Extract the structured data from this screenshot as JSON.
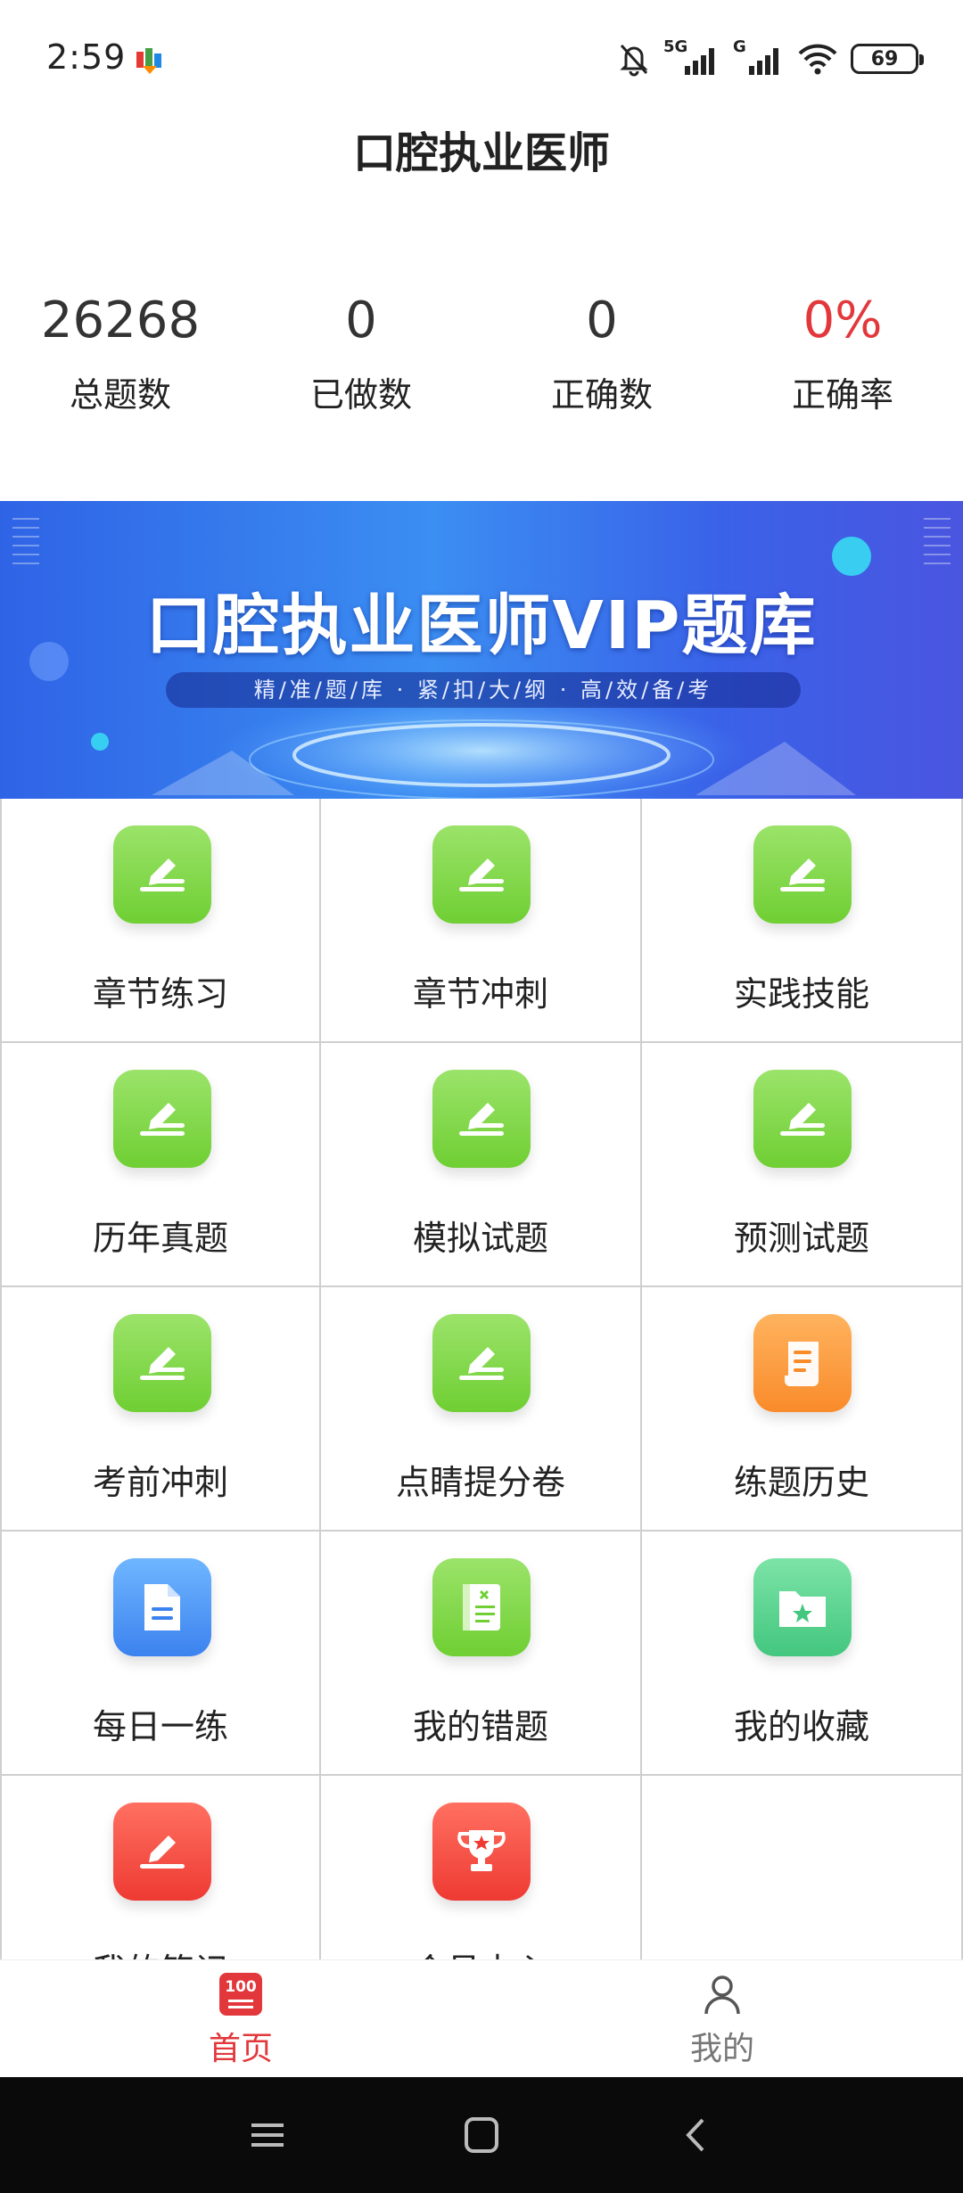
{
  "status_bar": {
    "time": "2:59",
    "network_1": "5G",
    "network_2": "G",
    "battery": "69"
  },
  "header": {
    "title": "口腔执业医师"
  },
  "stats": [
    {
      "value": "26268",
      "label": "总题数"
    },
    {
      "value": "0",
      "label": "已做数"
    },
    {
      "value": "0",
      "label": "正确数"
    },
    {
      "value": "0%",
      "label": "正确率"
    }
  ],
  "banner": {
    "title": "口腔执业医师VIP题库",
    "subtitle": "精/准/题/库 · 紧/扣/大/纲 · 高/效/备/考"
  },
  "grid": {
    "items": [
      {
        "label": "章节练习",
        "icon": "edit-icon"
      },
      {
        "label": "章节冲刺",
        "icon": "edit-icon"
      },
      {
        "label": "实践技能",
        "icon": "edit-icon"
      },
      {
        "label": "历年真题",
        "icon": "edit-icon"
      },
      {
        "label": "模拟试题",
        "icon": "edit-icon"
      },
      {
        "label": "预测试题",
        "icon": "edit-icon"
      },
      {
        "label": "考前冲刺",
        "icon": "edit-icon"
      },
      {
        "label": "点睛提分卷",
        "icon": "edit-icon"
      },
      {
        "label": "练题历史",
        "icon": "scroll-icon"
      },
      {
        "label": "每日一练",
        "icon": "document-icon"
      },
      {
        "label": "我的错题",
        "icon": "error-book-icon"
      },
      {
        "label": "我的收藏",
        "icon": "favorite-folder-icon"
      },
      {
        "label": "我的笔记",
        "icon": "note-icon"
      },
      {
        "label": "会员中心",
        "icon": "trophy-icon"
      }
    ]
  },
  "bottom_nav": {
    "home_badge": "100",
    "home_label": "首页",
    "mine_label": "我的"
  },
  "colors": {
    "accent_red": "#e2383c",
    "icon_green": "#7ed43f",
    "banner_blue": "#3b7cf0"
  }
}
